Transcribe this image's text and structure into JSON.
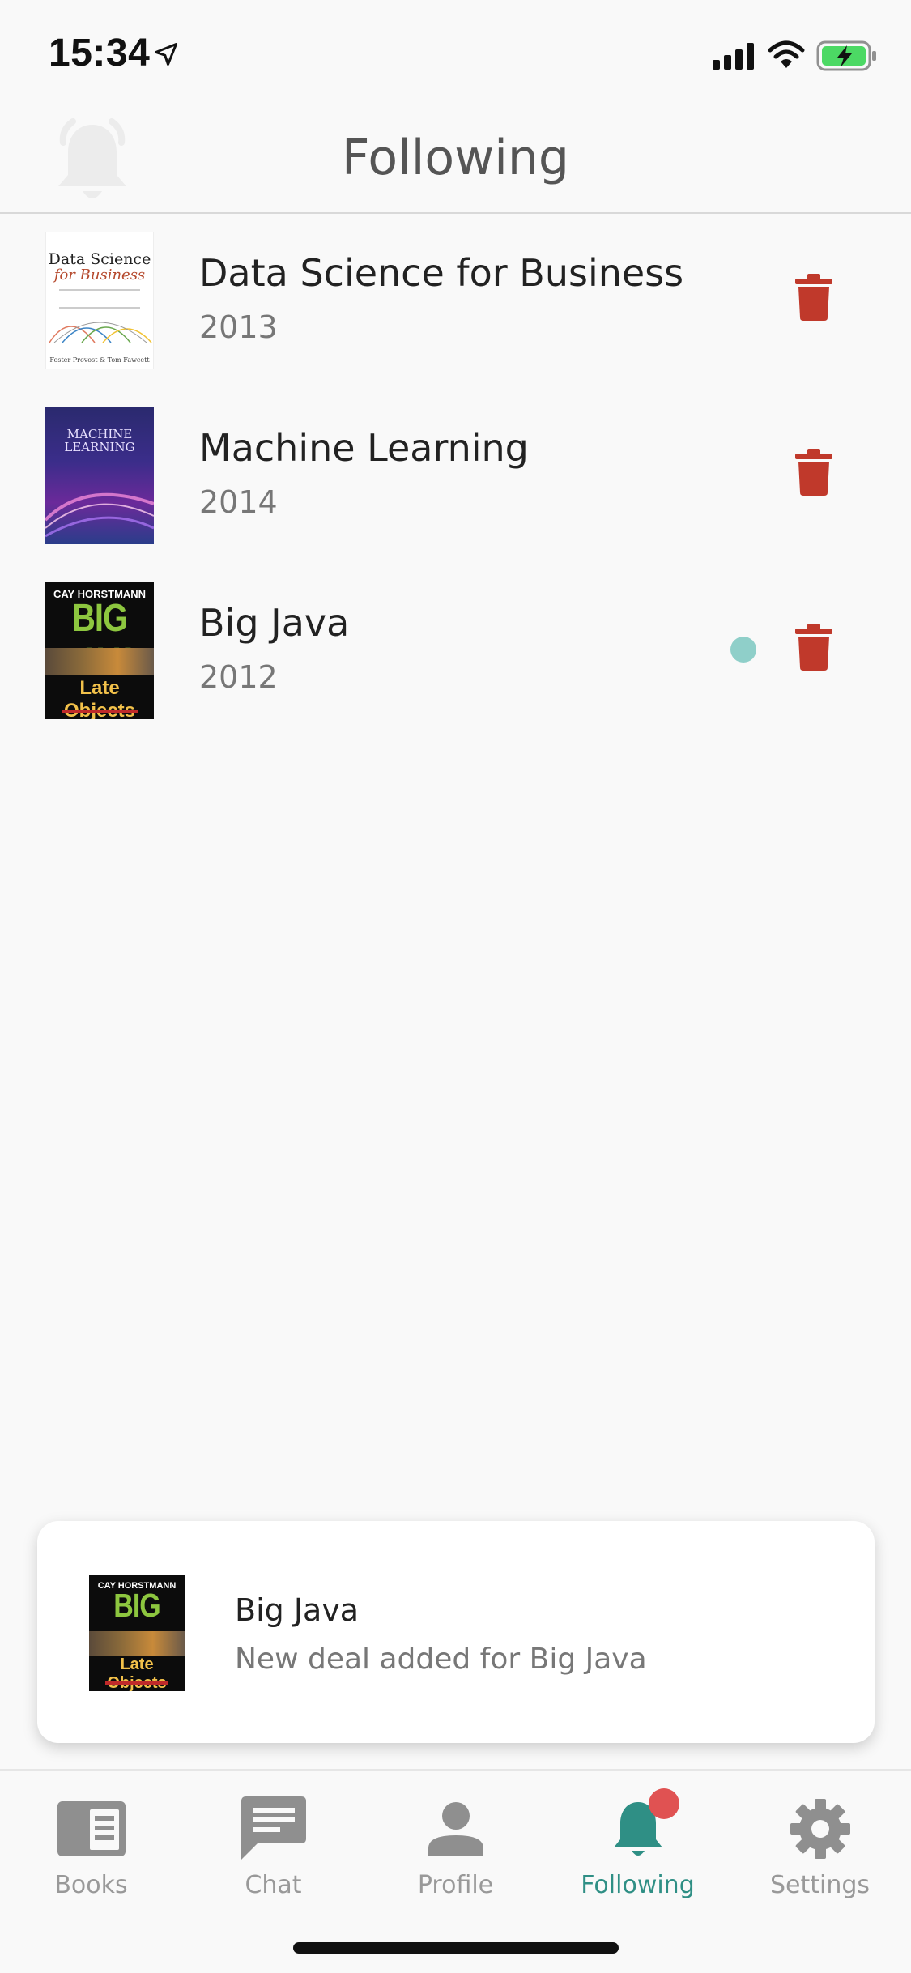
{
  "status_bar": {
    "time": "15:34",
    "battery_color": "#4cd964"
  },
  "header": {
    "title": "Following"
  },
  "following": [
    {
      "title": "Data Science for Business",
      "year": "2013",
      "has_update": false,
      "cover": {
        "title_line1": "Data Science",
        "title_line2": "for Business",
        "authors": "Foster Provost & Tom Fawcett"
      }
    },
    {
      "title": "Machine Learning",
      "year": "2014",
      "has_update": false,
      "cover": {
        "title_line1": "MACHINE",
        "title_line2": "LEARNING"
      }
    },
    {
      "title": "Big Java",
      "year": "2012",
      "has_update": true,
      "cover": {
        "author": "CAY HORSTMANN",
        "title_line1": "BIG JAVA",
        "title_line2": "Late Objects"
      }
    }
  ],
  "toast": {
    "title": "Big Java",
    "body": "New deal added for Big Java",
    "cover": {
      "author": "CAY HORSTMANN",
      "title_line1": "BIG JAVA",
      "title_line2": "Late Objects"
    }
  },
  "tabs": [
    {
      "label": "Books",
      "icon": "book-icon",
      "active": false
    },
    {
      "label": "Chat",
      "icon": "chat-icon",
      "active": false
    },
    {
      "label": "Profile",
      "icon": "person-icon",
      "active": false
    },
    {
      "label": "Following",
      "icon": "bell-icon",
      "active": true,
      "badge": true
    },
    {
      "label": "Settings",
      "icon": "gear-icon",
      "active": false
    }
  ],
  "colors": {
    "accent": "#2f8f85",
    "delete": "#c0392b",
    "update_dot": "#8fcfc9",
    "badge": "#e05252"
  }
}
